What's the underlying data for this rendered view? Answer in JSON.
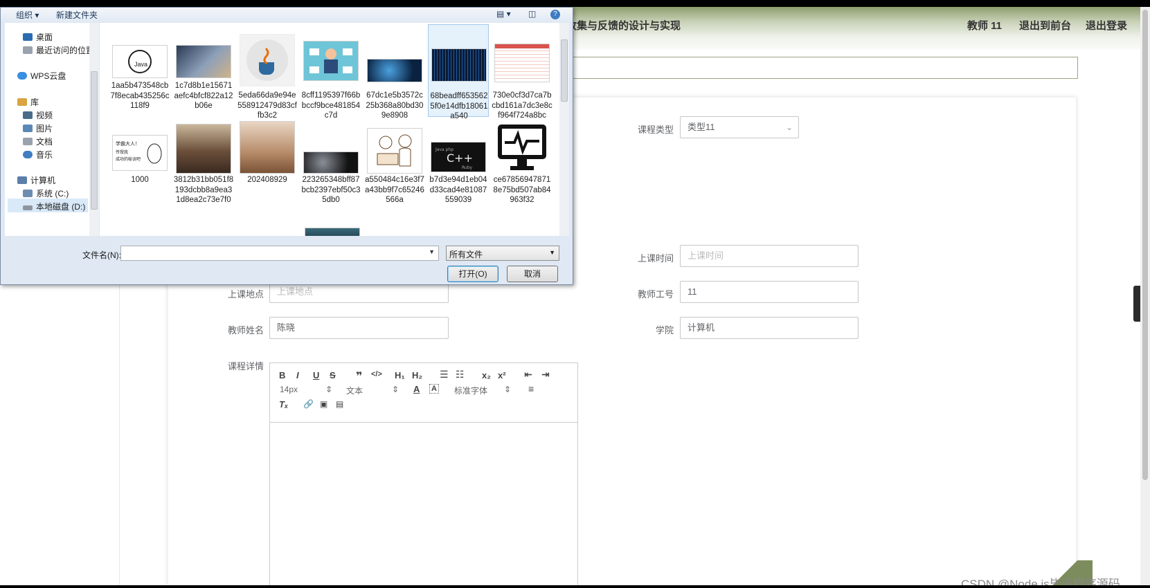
{
  "header": {
    "title": "收集与反馈的设计与实现",
    "user": "教师 11",
    "back_front": "退出到前台",
    "logout": "退出登录"
  },
  "form": {
    "course_type_label": "课程类型",
    "course_type_value": "类型11",
    "class_time_label": "上课时间",
    "class_time_placeholder": "上课时间",
    "location_label": "上课地点",
    "location_placeholder": "上课地点",
    "teacher_id_label": "教师工号",
    "teacher_id_value": "11",
    "teacher_name_label": "教师姓名",
    "teacher_name_value": "陈晓",
    "college_label": "学院",
    "college_value": "计算机",
    "details_label": "课程详情"
  },
  "editor": {
    "font_size": "14px",
    "text_style": "文本",
    "font_family": "标准字体"
  },
  "watermark": "CSDN @Node.js毕设程序源码",
  "dialog": {
    "organize": "组织 ▾",
    "new_folder": "新建文件夹",
    "nav": [
      {
        "label": "桌面",
        "color": "#2b6cb0"
      },
      {
        "label": "最近访问的位置",
        "color": "#9aa3ad"
      },
      {
        "label": "WPS云盘",
        "color": "#3b8fe0"
      },
      {
        "label": "库",
        "color": "#d9a441"
      },
      {
        "label": "视频",
        "color": "#4a6b8a"
      },
      {
        "label": "图片",
        "color": "#5a89b5"
      },
      {
        "label": "文档",
        "color": "#9aa3ad"
      },
      {
        "label": "音乐",
        "color": "#3f7ec0"
      },
      {
        "label": "计算机",
        "color": "#5b7fa8"
      },
      {
        "label": "系统 (C:)",
        "color": "#6d8db0"
      },
      {
        "label": "本地磁盘 (D:)",
        "color": "#8c96a1"
      }
    ],
    "files": [
      {
        "name": "1aa5b473548cb7f8ecab435256c118f9",
        "thumb": "java-logo"
      },
      {
        "name": "1c7d8b1e15671aefc4bfcf822a12b06e",
        "thumb": "laptop-photo"
      },
      {
        "name": "5eda66da9e94e558912479d83cffb3c2",
        "thumb": "java-cup"
      },
      {
        "name": "8cff1195397f66bbccf9bce481854c7d",
        "thumb": "illustration"
      },
      {
        "name": "67dc1e5b3572c25b368a80bd309e8908",
        "thumb": "ai-head"
      },
      {
        "name": "68beadff6535625f0e14dfb18061a540",
        "thumb": "binary-code"
      },
      {
        "name": "730e0cf3d7ca7bcbd161a7dc3e8cf964f724a8bc",
        "thumb": "table-document"
      },
      {
        "name": "1000",
        "thumb": "cartoon-text"
      },
      {
        "name": "3812b31bb051f8193dcbb8a9ea31d8ea2c73e7f0",
        "thumb": "meeting-room"
      },
      {
        "name": "202408929",
        "thumb": "child-guitar"
      },
      {
        "name": "223265348bff87bcb2397ebf50c35db0",
        "thumb": "dark-face"
      },
      {
        "name": "a550484c16e3f7a43bb9f7c65246566a",
        "thumb": "sketch-people"
      },
      {
        "name": "b7d3e94d1eb04d33cad4e81087559039",
        "thumb": "code-words"
      },
      {
        "name": "ce678569478718e75bd507ab84963f32",
        "thumb": "monitor-icon"
      }
    ],
    "filename_label": "文件名(N):",
    "filename_value": "",
    "filetype": "所有文件",
    "open": "打开(O)",
    "cancel": "取消"
  }
}
